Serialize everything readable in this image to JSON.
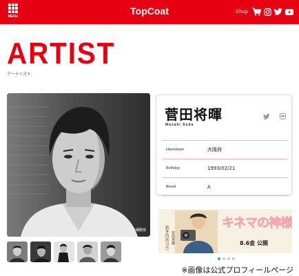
{
  "header": {
    "brand": "TopCoat",
    "menu_label": "MENU",
    "shop_label": "Shop"
  },
  "page": {
    "title": "ARTIST",
    "subtitle": "アーティスト"
  },
  "artist": {
    "name_jp": "菅田将暉",
    "name_en": "Masaki Suda",
    "photo_credit": "©細野晃",
    "profile": [
      {
        "key": "Hometown",
        "value": "大阪府"
      },
      {
        "key": "Birthday",
        "value": "1993/02/21"
      },
      {
        "key": "Blood",
        "value": "A"
      }
    ]
  },
  "banner": {
    "left_text": "若き日のゴウ",
    "role_text": "菅田将暉",
    "title": "キネマの神様",
    "date": "8.6金 公開"
  },
  "caption": "※画像は公式プロフィールページ",
  "colors": {
    "brand_red": "#e60012",
    "carousel_active": "#3aa0d8"
  }
}
